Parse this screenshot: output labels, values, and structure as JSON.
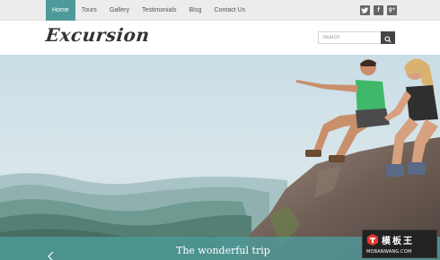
{
  "nav": {
    "items": [
      {
        "label": "Home",
        "active": true
      },
      {
        "label": "Tours",
        "active": false
      },
      {
        "label": "Gallery",
        "active": false
      },
      {
        "label": "Testimonials",
        "active": false
      },
      {
        "label": "Blog",
        "active": false
      },
      {
        "label": "Contact Us",
        "active": false
      }
    ],
    "active_color": "#4e9a9a"
  },
  "social": {
    "icons": [
      "twitter-icon",
      "facebook-icon",
      "google-plus-icon"
    ],
    "facebook_glyph": "f",
    "google_glyph": "g+"
  },
  "header": {
    "logo": "Excursion",
    "search_placeholder": "Search"
  },
  "hero": {
    "caption": "The wonderful trip",
    "band_color": "#4e9a9a"
  },
  "watermark": {
    "text_cn": "模板王",
    "text_en": "MOBANWANG.COM"
  }
}
